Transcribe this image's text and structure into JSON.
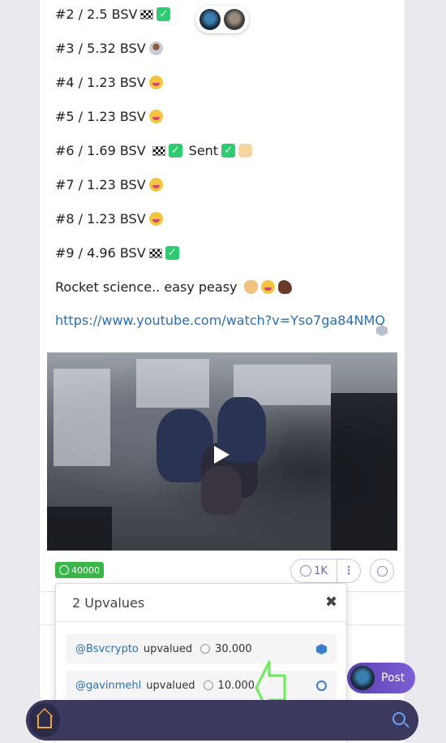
{
  "post": {
    "lines": [
      {
        "text": "#2 / 2.5 BSV",
        "emojis": [
          "checkered-flag",
          "check-mark"
        ]
      },
      {
        "text": "#3 / 5.32 BSV",
        "emojis": [
          "astronaut"
        ]
      },
      {
        "text": "#4 / 1.23 BSV",
        "emojis": [
          "zany-face"
        ]
      },
      {
        "text": "#5 / 1.23 BSV",
        "emojis": [
          "zany-face"
        ]
      },
      {
        "text": "#6 / 1.69 BSV",
        "sent": "Sent",
        "emojis": [
          "checkered-flag",
          "check-mark",
          "check-mark",
          "raised-hands"
        ]
      },
      {
        "text": "#7 / 1.23 BSV",
        "emojis": [
          "zany-face"
        ]
      },
      {
        "text": "#8 / 1.23 BSV",
        "emojis": [
          "zany-face"
        ]
      },
      {
        "text": "#9 / 4.96 BSV",
        "emojis": [
          "checkered-flag",
          "check-mark"
        ]
      },
      {
        "text": "Rocket science.. easy peasy",
        "emojis": [
          "fist-bump",
          "zany-face",
          "horse"
        ]
      }
    ],
    "link": "https://www.youtube.com/watch?v=Yso7ga84NMQ",
    "tip_amount": "40000",
    "upvalue_count": "1K"
  },
  "upvalues_popup": {
    "title": "2 Upvalues",
    "close": "✖",
    "rows": [
      {
        "user": "@Bsvcrypto",
        "action": "upvalued",
        "amount": "30.000",
        "icon": "cube-icon"
      },
      {
        "user": "@gavinmehl",
        "action": "upvalued",
        "amount": "10.000",
        "icon": "clock-icon"
      }
    ]
  },
  "post_button": {
    "label": "Post"
  },
  "colors": {
    "accent": "#6b5fc7",
    "tip_green": "#39b54a",
    "link": "#2b6fb3",
    "bar": "#3b3a5e",
    "arrow": "#66ee55"
  }
}
